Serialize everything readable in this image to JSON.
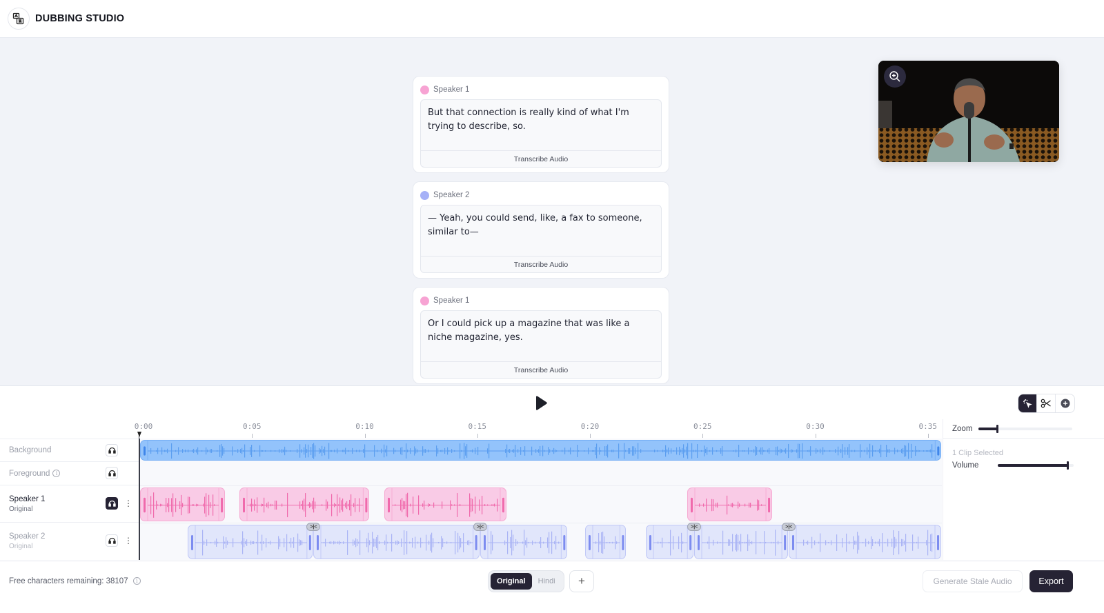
{
  "app": {
    "title": "DUBBING STUDIO",
    "logo_icon": "translate-icon"
  },
  "segments": [
    {
      "speaker": "Speaker 1",
      "color": "#f7a3d3",
      "text": " But that connection is really kind of what I'm trying to describe, so.",
      "action": "Transcribe Audio"
    },
    {
      "speaker": "Speaker 2",
      "color": "#a6b1f7",
      "text": " — Yeah, you could send, like, a fax to someone, similar to—",
      "action": "Transcribe Audio"
    },
    {
      "speaker": "Speaker 1",
      "color": "#f7a3d3",
      "text": " Or I could pick up a magazine that was like a niche magazine, yes.",
      "action": "Transcribe Audio"
    }
  ],
  "video": {
    "zoom_icon": "zoom-in-icon"
  },
  "player": {
    "play_icon": "play-icon"
  },
  "tools": [
    {
      "name": "select-tool",
      "icon": "cursor-click-icon",
      "active": true
    },
    {
      "name": "split-tool",
      "icon": "scissors-icon",
      "active": false
    },
    {
      "name": "add-tool",
      "icon": "plus-circle-icon",
      "active": false
    }
  ],
  "timeline": {
    "ticks": [
      "0:00",
      "0:05",
      "0:10",
      "0:15",
      "0:20",
      "0:25",
      "0:30",
      "0:35"
    ],
    "tick_interval_seconds": 5,
    "tracks": [
      {
        "name": "Background",
        "sub": "",
        "info": false,
        "kebab": false,
        "headphones_active": false
      },
      {
        "name": "Foreground",
        "sub": "",
        "info": true,
        "kebab": false,
        "headphones_active": false
      },
      {
        "name": "Speaker 1",
        "sub": "Original",
        "info": false,
        "kebab": true,
        "headphones_active": true
      },
      {
        "name": "Speaker 2",
        "sub": "Original",
        "info": false,
        "kebab": true,
        "headphones_active": false
      }
    ],
    "clips": {
      "background": [
        {
          "start": 0.0,
          "end": 35.6
        }
      ],
      "speaker1": [
        {
          "start": 0.0,
          "end": 3.8
        },
        {
          "start": 4.4,
          "end": 10.2
        },
        {
          "start": 10.85,
          "end": 16.3
        },
        {
          "start": 24.3,
          "end": 28.1
        }
      ],
      "speaker2": [
        {
          "start": 2.1,
          "end": 7.7
        },
        {
          "start": 7.7,
          "end": 15.1
        },
        {
          "start": 15.1,
          "end": 19.0
        },
        {
          "start": 19.75,
          "end": 21.6
        },
        {
          "start": 22.45,
          "end": 24.6
        },
        {
          "start": 24.6,
          "end": 28.8
        },
        {
          "start": 28.8,
          "end": 35.6
        }
      ],
      "merge_points": [
        7.7,
        15.1,
        24.6,
        28.8
      ]
    },
    "colors": {
      "background": "#93c3fb",
      "speaker1": "#f9cbe6",
      "speaker2": "#e1e6fb"
    }
  },
  "panel": {
    "zoom_label": "Zoom",
    "zoom_level": 0.2,
    "clip_selected": "1 Clip Selected",
    "volume_label": "Volume",
    "volume_level": 0.92
  },
  "footer": {
    "free_chars": "Free characters remaining: 38107",
    "languages": [
      {
        "label": "Original",
        "active": true
      },
      {
        "label": "Hindi",
        "active": false
      }
    ],
    "add_language": "+",
    "generate": "Generate Stale Audio",
    "export": "Export"
  }
}
